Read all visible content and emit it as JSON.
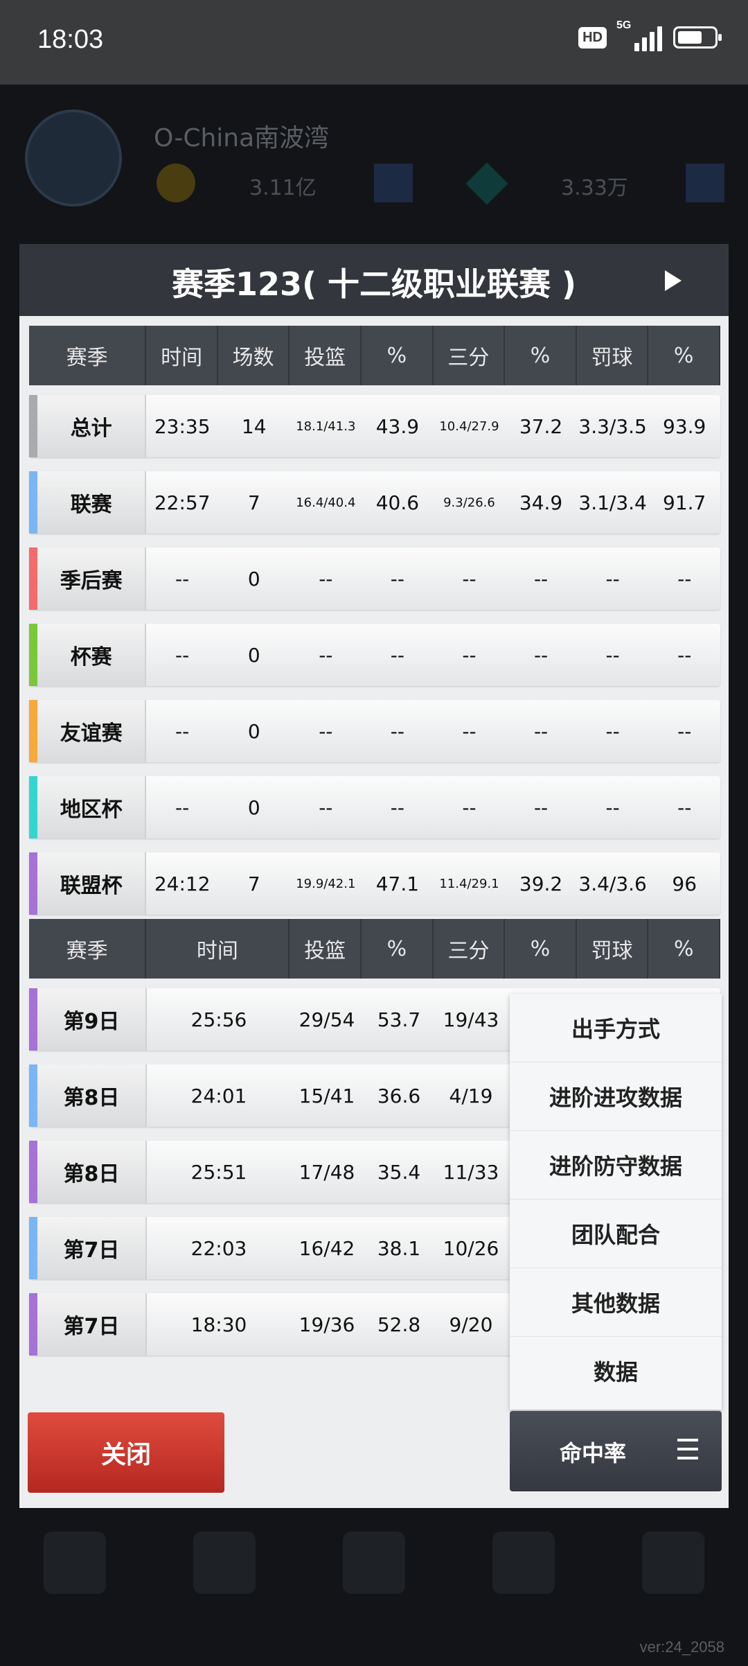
{
  "status_bar": {
    "time": "18:03",
    "hd": "HD",
    "network": "5G"
  },
  "background": {
    "player_name": "O-China南波湾",
    "coins": "3.11亿",
    "gems": "3.33万"
  },
  "modal": {
    "title": "赛季123( 十二级职业联赛 )",
    "table1": {
      "headers": [
        "赛季",
        "时间",
        "场数",
        "投篮",
        "%",
        "三分",
        "%",
        "罚球",
        "%"
      ],
      "rows": [
        {
          "label": "总计",
          "color": "#a8aaad",
          "values": [
            "23:35",
            "14",
            "18.1/41.3",
            "43.9",
            "10.4/27.9",
            "37.2",
            "3.3/3.5",
            "93.9"
          ]
        },
        {
          "label": "联赛",
          "color": "#7ab6f5",
          "values": [
            "22:57",
            "7",
            "16.4/40.4",
            "40.6",
            "9.3/26.6",
            "34.9",
            "3.1/3.4",
            "91.7"
          ]
        },
        {
          "label": "季后赛",
          "color": "#f36b6b",
          "values": [
            "--",
            "0",
            "--",
            "--",
            "--",
            "--",
            "--",
            "--"
          ]
        },
        {
          "label": "杯赛",
          "color": "#7bc73a",
          "values": [
            "--",
            "0",
            "--",
            "--",
            "--",
            "--",
            "--",
            "--"
          ]
        },
        {
          "label": "友谊赛",
          "color": "#f7a93a",
          "values": [
            "--",
            "0",
            "--",
            "--",
            "--",
            "--",
            "--",
            "--"
          ]
        },
        {
          "label": "地区杯",
          "color": "#33d6cf",
          "values": [
            "--",
            "0",
            "--",
            "--",
            "--",
            "--",
            "--",
            "--"
          ]
        },
        {
          "label": "联盟杯",
          "color": "#a771d6",
          "values": [
            "24:12",
            "7",
            "19.9/42.1",
            "47.1",
            "11.4/29.1",
            "39.2",
            "3.4/3.6",
            "96"
          ]
        }
      ]
    },
    "table2": {
      "headers": [
        "赛季",
        "时间",
        "投篮",
        "%",
        "三分",
        "%",
        "罚球",
        "%"
      ],
      "rows": [
        {
          "label": "第9日",
          "color": "#a771d6",
          "values": [
            "25:56",
            "29/54",
            "53.7",
            "19/43"
          ]
        },
        {
          "label": "第8日",
          "color": "#7ab6f5",
          "values": [
            "24:01",
            "15/41",
            "36.6",
            "4/19"
          ]
        },
        {
          "label": "第8日",
          "color": "#a771d6",
          "values": [
            "25:51",
            "17/48",
            "35.4",
            "11/33"
          ]
        },
        {
          "label": "第7日",
          "color": "#7ab6f5",
          "values": [
            "22:03",
            "16/42",
            "38.1",
            "10/26"
          ]
        },
        {
          "label": "第7日",
          "color": "#a771d6",
          "values": [
            "18:30",
            "19/36",
            "52.8",
            "9/20"
          ]
        }
      ]
    },
    "menu": [
      "出手方式",
      "进阶进攻数据",
      "进阶防守数据",
      "团队配合",
      "其他数据",
      "数据"
    ],
    "close_label": "关闭",
    "rate_label": "命中率"
  },
  "version": "ver:24_2058"
}
